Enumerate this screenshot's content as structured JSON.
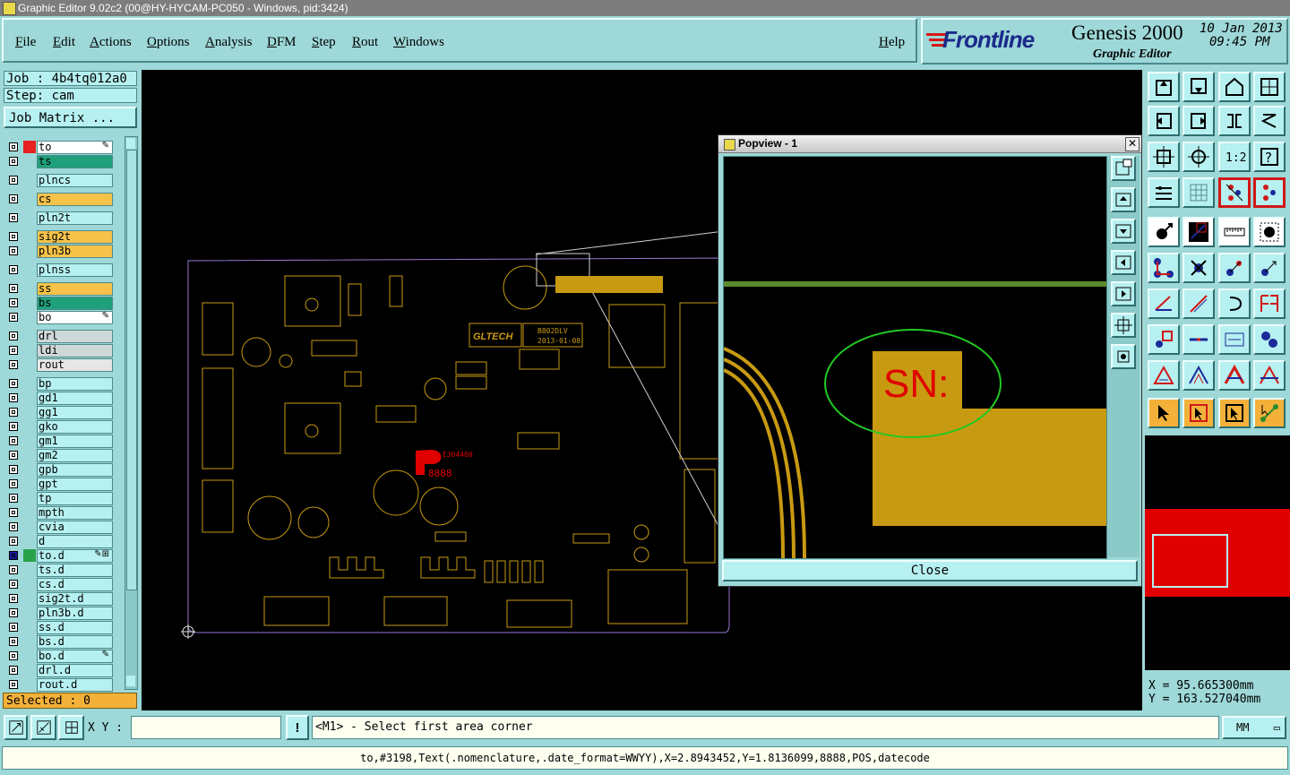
{
  "window": {
    "title": "Graphic Editor 9.02c2 (00@HY-HYCAM-PC050 - Windows, pid:3424)"
  },
  "menu": [
    {
      "label": "File"
    },
    {
      "label": "Edit"
    },
    {
      "label": "Actions"
    },
    {
      "label": "Options"
    },
    {
      "label": "Analysis"
    },
    {
      "label": "DFM"
    },
    {
      "label": "Step"
    },
    {
      "label": "Rout"
    },
    {
      "label": "Windows"
    }
  ],
  "help_label": "Help",
  "logo": {
    "brand": "Frontline",
    "product": "Genesis 2000",
    "subtitle": "Graphic Editor",
    "date": "10 Jan 2013",
    "time": "09:45 PM"
  },
  "job": {
    "job_text": "Job : 4b4tq012a0",
    "step_text": "Step: cam",
    "matrix_button": "Job Matrix ..."
  },
  "layers": [
    {
      "name": "to",
      "swatch": "#e82020",
      "bg": "#ffffff",
      "edit": "✎"
    },
    {
      "name": "ts",
      "swatch": "",
      "bg": "#1fa07a",
      "edit": ""
    },
    {
      "name": "plncs",
      "swatch": "",
      "bg": "#b7f0f0",
      "edit": ""
    },
    {
      "name": "cs",
      "swatch": "",
      "bg": "#f6c24a",
      "edit": ""
    },
    {
      "name": "pln2t",
      "swatch": "",
      "bg": "#b7f0f0",
      "edit": ""
    },
    {
      "name": "sig2t",
      "swatch": "",
      "bg": "#f6c24a",
      "edit": ""
    },
    {
      "name": "pln3b",
      "swatch": "",
      "bg": "#f6c24a",
      "edit": ""
    },
    {
      "name": "plnss",
      "swatch": "",
      "bg": "#b7f0f0",
      "edit": ""
    },
    {
      "name": "ss",
      "swatch": "",
      "bg": "#f6c24a",
      "edit": ""
    },
    {
      "name": "bs",
      "swatch": "",
      "bg": "#1fa07a",
      "edit": ""
    },
    {
      "name": "bo",
      "swatch": "",
      "bg": "#ffffff",
      "edit": "✎"
    },
    {
      "name": "drl",
      "swatch": "",
      "bg": "#cfd8d8",
      "edit": ""
    },
    {
      "name": "ldi",
      "swatch": "",
      "bg": "#cfd8d8",
      "edit": ""
    },
    {
      "name": "rout",
      "swatch": "",
      "bg": "#e6e6e6",
      "edit": ""
    },
    {
      "name": "bp",
      "swatch": "",
      "bg": "#b7f0f0",
      "edit": ""
    },
    {
      "name": "gd1",
      "swatch": "",
      "bg": "#b7f0f0",
      "edit": ""
    },
    {
      "name": "gg1",
      "swatch": "",
      "bg": "#b7f0f0",
      "edit": ""
    },
    {
      "name": "gko",
      "swatch": "",
      "bg": "#b7f0f0",
      "edit": ""
    },
    {
      "name": "gm1",
      "swatch": "",
      "bg": "#b7f0f0",
      "edit": ""
    },
    {
      "name": "gm2",
      "swatch": "",
      "bg": "#b7f0f0",
      "edit": ""
    },
    {
      "name": "gpb",
      "swatch": "",
      "bg": "#b7f0f0",
      "edit": ""
    },
    {
      "name": "gpt",
      "swatch": "",
      "bg": "#b7f0f0",
      "edit": ""
    },
    {
      "name": "tp",
      "swatch": "",
      "bg": "#b7f0f0",
      "edit": ""
    },
    {
      "name": "mpth",
      "swatch": "",
      "bg": "#b7f0f0",
      "edit": ""
    },
    {
      "name": "cvia",
      "swatch": "",
      "bg": "#b7f0f0",
      "edit": ""
    },
    {
      "name": "d",
      "swatch": "",
      "bg": "#b7f0f0",
      "edit": ""
    },
    {
      "name": "to.d",
      "swatch": "#2aa24a",
      "bg": "#b7f0f0",
      "edit": "✎⊞",
      "checked": true
    },
    {
      "name": "ts.d",
      "swatch": "",
      "bg": "#b7f0f0",
      "edit": ""
    },
    {
      "name": "cs.d",
      "swatch": "",
      "bg": "#b7f0f0",
      "edit": ""
    },
    {
      "name": "sig2t.d",
      "swatch": "",
      "bg": "#b7f0f0",
      "edit": ""
    },
    {
      "name": "pln3b.d",
      "swatch": "",
      "bg": "#b7f0f0",
      "edit": ""
    },
    {
      "name": "ss.d",
      "swatch": "",
      "bg": "#b7f0f0",
      "edit": ""
    },
    {
      "name": "bs.d",
      "swatch": "",
      "bg": "#b7f0f0",
      "edit": ""
    },
    {
      "name": "bo.d",
      "swatch": "",
      "bg": "#b7f0f0",
      "edit": "✎"
    },
    {
      "name": "drl.d",
      "swatch": "",
      "bg": "#b7f0f0",
      "edit": ""
    },
    {
      "name": "rout.d",
      "swatch": "",
      "bg": "#b7f0f0",
      "edit": ""
    }
  ],
  "selected_text": "Selected : 0",
  "board": {
    "brand_label": "GLTECH",
    "model": "B802DLV",
    "date": "2013-01-08",
    "red_code": "E304460",
    "red_mark": "8888"
  },
  "popview": {
    "title": "Popview - 1",
    "close_label": "Close",
    "sn_text": "SN:"
  },
  "coords": {
    "x_text": "X =  95.665300mm",
    "y_text": "Y = 163.527040mm"
  },
  "bottom": {
    "xy_label": "X Y :",
    "xy_value": "",
    "prompt": "<M1> - Select first area corner",
    "units": "MM",
    "command": "to,#3198,Text(.nomenclature,.date_format=WWYY),X=2.8943452,Y=1.8136099,8888,POS,datecode"
  },
  "colors": {
    "panel": "#9ed8d8",
    "canvas": "#000000",
    "copper": "#c89a12",
    "silkscreen_red": "#e00000",
    "highlight_green": "#22c822",
    "selected_bg": "#f3b13a"
  }
}
